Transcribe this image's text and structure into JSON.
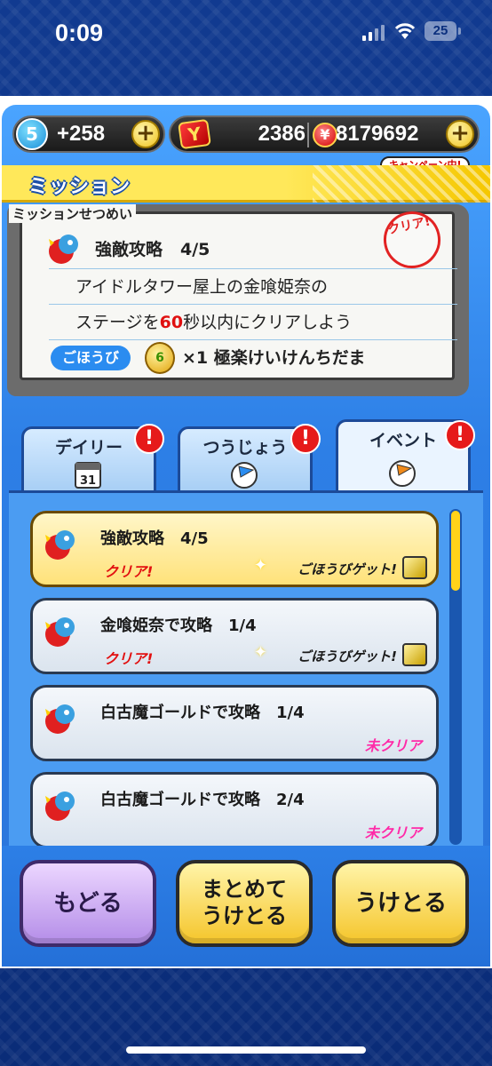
{
  "status_bar": {
    "time": "0:09",
    "battery": "25"
  },
  "top_bar": {
    "stamina_level": "5",
    "stamina_value": "+258",
    "gem_icon_letter": "Y",
    "gems": "2386",
    "money": "8179692",
    "campaign_tag": "キャンペーン中!"
  },
  "mission": {
    "header": "ミッション",
    "description_label": "ミッションせつめい",
    "title": "強敵攻略",
    "progress": "4/5",
    "line1": "アイドルタワー屋上の金喰姫奈の",
    "line2_prefix": "ステージを",
    "line2_number": "60",
    "line2_suffix": "秒以内にクリアしよう",
    "reward_label": "ごほうび",
    "medal_text": "6",
    "reward_text": "×1 極楽けいけんちだま",
    "clear_stamp": "クリア!"
  },
  "tabs": [
    {
      "label": "デイリー",
      "badge": "!"
    },
    {
      "label": "つうじょう",
      "badge": "!"
    },
    {
      "label": "イベント",
      "badge": "!"
    }
  ],
  "list_items": [
    {
      "title": "強敵攻略",
      "progress": "4/5",
      "status": "クリア!",
      "reward": "ごほうびゲット!"
    },
    {
      "title": "金喰姫奈で攻略",
      "progress": "1/4",
      "status": "クリア!",
      "reward": "ごほうびゲット!"
    },
    {
      "title": "白古魔ゴールドで攻略",
      "progress": "1/4",
      "status": "未クリア"
    },
    {
      "title": "白古魔ゴールドで攻略",
      "progress": "2/4",
      "status": "未クリア"
    }
  ],
  "buttons": {
    "back": "もどる",
    "receive_all_line1": "まとめて",
    "receive_all_line2": "うけとる",
    "receive": "うけとる"
  },
  "colors": {
    "accent_yellow": "#ffe85a",
    "clear_red": "#e21010",
    "not_clear_pink": "#ff2aa8",
    "game_blue": "#2d7fe6"
  }
}
